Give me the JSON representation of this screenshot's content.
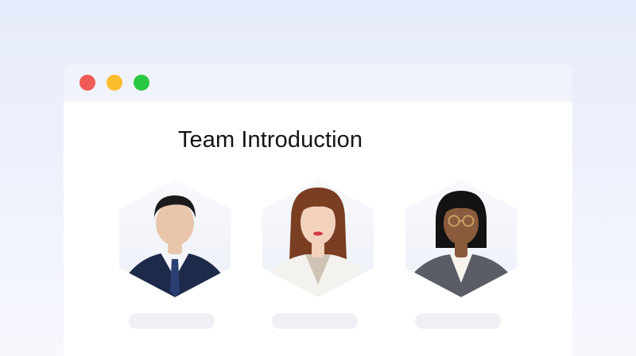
{
  "window": {
    "controls": [
      {
        "name": "close",
        "color": "#f05a57"
      },
      {
        "name": "minimize",
        "color": "#fbbd2e"
      },
      {
        "name": "maximize",
        "color": "#27c840"
      }
    ]
  },
  "page": {
    "title": "Team Introduction"
  },
  "team": {
    "members": [
      {
        "avatar": "man-in-navy-suit-with-striped-tie",
        "hair": "#1c1a1a",
        "skin": "#e9c6ab",
        "suit": "#1d2a4a",
        "shirt": "#f4f6fb",
        "accent": "#2b3f72"
      },
      {
        "avatar": "woman-with-auburn-bob-in-white-blazer",
        "hair": "#7a3e22",
        "skin": "#f2d1bd",
        "suit": "#f4f2ee",
        "shirt": "#cfc3b4",
        "accent": "#d33a45"
      },
      {
        "avatar": "woman-with-glasses-in-gray-blazer",
        "hair": "#141212",
        "skin": "#8a5a3c",
        "suit": "#5a5d66",
        "shirt": "#f7f4ee",
        "accent": "#c9a063"
      }
    ]
  }
}
